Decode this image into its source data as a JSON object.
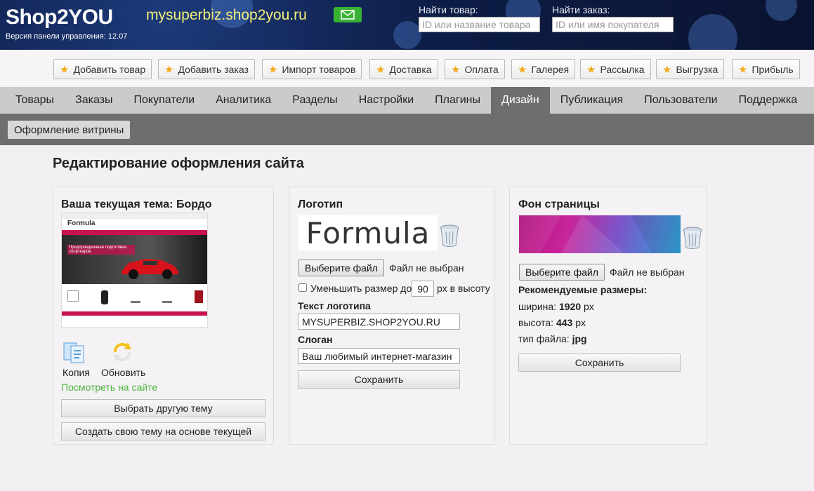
{
  "header": {
    "logo": "Shop2YOU",
    "version_label": "Версия панели управления: 12.07",
    "site": "mysuperbiz.shop2you.ru",
    "find_product_label": "Найти товар:",
    "find_product_placeholder": "ID или название товара",
    "find_order_label": "Найти заказ:",
    "find_order_placeholder": "ID или имя покупателя",
    "mail_icon": "envelope-icon"
  },
  "quick": [
    {
      "label": "Добавить товар"
    },
    {
      "label": "Добавить заказ"
    },
    {
      "label": "Импорт товаров"
    },
    {
      "label": "Доставка"
    },
    {
      "label": "Оплата"
    },
    {
      "label": "Галерея"
    },
    {
      "label": "Рассылка"
    },
    {
      "label": "Выгрузка"
    },
    {
      "label": "Прибыль"
    }
  ],
  "nav": [
    {
      "label": "Товары"
    },
    {
      "label": "Заказы"
    },
    {
      "label": "Покупатели"
    },
    {
      "label": "Аналитика"
    },
    {
      "label": "Разделы"
    },
    {
      "label": "Настройки"
    },
    {
      "label": "Плагины"
    },
    {
      "label": "Дизайн",
      "active": true
    },
    {
      "label": "Публикация"
    },
    {
      "label": "Пользователи"
    },
    {
      "label": "Поддержка"
    }
  ],
  "subnav": {
    "active": "Оформление витрины"
  },
  "page_title": "Редактирование оформления сайта",
  "theme_panel": {
    "title": "Ваша текущая тема: Бордо",
    "preview": {
      "brand": "Formula",
      "banner_text": "Предпраздничная подготовка спорткаров"
    },
    "copy_label": "Копия",
    "refresh_label": "Обновить",
    "view_link": "Посмотреть на сайте",
    "choose_btn": "Выбрать другую тему",
    "create_btn": "Создать свою тему на основе текущей"
  },
  "logo_panel": {
    "title": "Логотип",
    "logo_text": "Formula",
    "file_btn": "Выберите файл",
    "no_file": "Файл не выбран",
    "shrink_label": "Уменьшить размер до",
    "shrink_value": "90",
    "shrink_unit": "px в высоту",
    "logo_text_label": "Текст логотипа",
    "logo_text_value": "MYSUPERBIZ.SHOP2YOU.RU",
    "slogan_label": "Слоган",
    "slogan_value": "Ваш любимый интернет-магазин",
    "save_btn": "Сохранить"
  },
  "bg_panel": {
    "title": "Фон страницы",
    "file_btn": "Выберите файл",
    "no_file": "Файл не выбран",
    "recommended": "Рекомендуемые размеры:",
    "width_label": "ширина:",
    "width_value": "1920",
    "width_unit": "px",
    "height_label": "высота:",
    "height_value": "443",
    "height_unit": "px",
    "type_label": "тип файла:",
    "type_value": "jpg",
    "save_btn": "Сохранить"
  },
  "colors": {
    "accent_green": "#4bb43c",
    "star": "#f3a91b",
    "header_bg": "#0e1e48",
    "site_link": "#f4f07a"
  }
}
